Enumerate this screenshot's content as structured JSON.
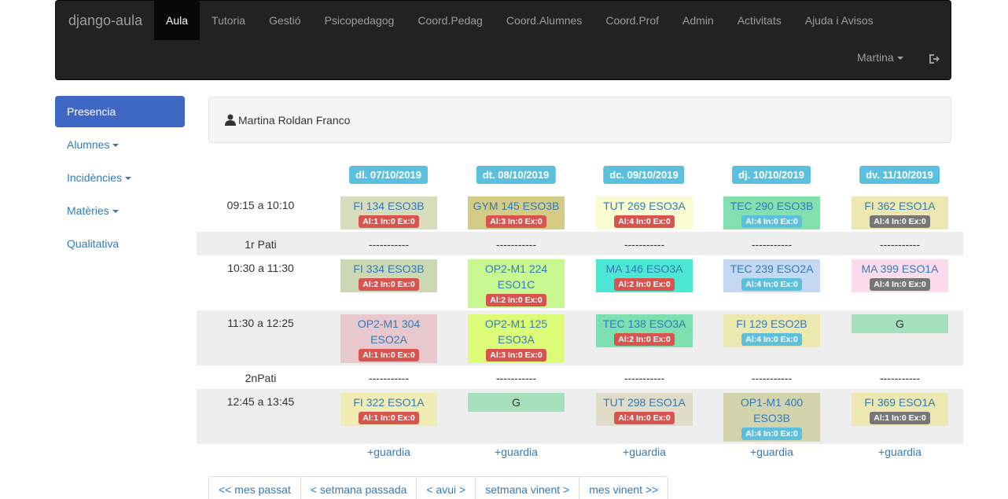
{
  "navbar": {
    "brand": "django-aula",
    "items": [
      "Aula",
      "Tutoria",
      "Gestió",
      "Psicopedagog",
      "Coord.Pedag",
      "Coord.Alumnes",
      "Coord.Prof",
      "Admin",
      "Activitats",
      "Ajuda i Avisos"
    ],
    "user": "Martina"
  },
  "sidebar": {
    "items": [
      "Presencia",
      "Alumnes",
      "Incidències",
      "Matèries",
      "Qualitativa"
    ]
  },
  "teacher": {
    "name": "Martina Roldan Franco"
  },
  "schedule": {
    "days": [
      "dl. 07/10/2019",
      "dt. 08/10/2019",
      "dc. 09/10/2019",
      "dj. 10/10/2019",
      "dv. 11/10/2019"
    ],
    "rows": [
      {
        "time": "09:15 a 10:10",
        "cells": [
          {
            "text": "FI 134 ESO3B",
            "badge": "Al:1 In:0 Ex:0",
            "badge_color": "red",
            "bg": "#d6dcbc"
          },
          {
            "text": "GYM 145 ESO3B",
            "badge": "Al:3 In:0 Ex:0",
            "badge_color": "red",
            "bg": "#d4cc84"
          },
          {
            "text": "TUT 269 ESO3A",
            "badge": "Al:4 In:0 Ex:0",
            "badge_color": "red",
            "bg": "#f8fcd0"
          },
          {
            "text": "TEC 290 ESO3B",
            "badge": "Al:4 In:0 Ex:0",
            "badge_color": "blue",
            "bg": "#84e0ac"
          },
          {
            "text": "FI 362 ESO1A",
            "badge": "Al:4 In:0 Ex:0",
            "badge_color": "gray",
            "bg": "#ece8b0"
          }
        ]
      },
      {
        "time": "1r Pati",
        "dashes": [
          "-----------",
          "-----------",
          "-----------",
          "-----------",
          "-----------"
        ]
      },
      {
        "time": "10:30 a 11:30",
        "cells": [
          {
            "text": "FI 334 ESO3B",
            "badge": "Al:2 In:0 Ex:0",
            "badge_color": "red",
            "bg": "#ccd8b4"
          },
          {
            "text": "OP2-M1 224 ESO1C",
            "badge": "Al:2 In:0 Ex:0",
            "badge_color": "red",
            "bg": "#c8f890"
          },
          {
            "text": "MA 146 ESO3A",
            "badge": "Al:2 In:0 Ex:0",
            "badge_color": "red",
            "bg": "#4ce8d4"
          },
          {
            "text": "TEC 239 ESO2A",
            "badge": "Al:4 In:0 Ex:0",
            "badge_color": "blue",
            "bg": "#c4d8f4"
          },
          {
            "text": "MA 399 ESO1A",
            "badge": "Al:4 In:0 Ex:0",
            "badge_color": "gray",
            "bg": "#fcdcec"
          }
        ]
      },
      {
        "time": "11:30 a 12:25",
        "cells": [
          {
            "text": "OP2-M1 304 ESO2A",
            "badge": "Al:1 In:0 Ex:0",
            "badge_color": "red",
            "bg": "#e8c8cc"
          },
          {
            "text": "OP2-M1 125 ESO3A",
            "badge": "Al:3 In:0 Ex:0",
            "badge_color": "red",
            "bg": "#dcfc78"
          },
          {
            "text": "TEC 138 ESO3A",
            "badge": "Al:2 In:0 Ex:0",
            "badge_color": "red",
            "bg": "#7ce0b0"
          },
          {
            "text": "FI 129 ESO2B",
            "badge": "Al:4 In:0 Ex:0",
            "badge_color": "blue",
            "bg": "#ece8b0"
          },
          {
            "text": "G",
            "badge": "",
            "badge_color": "",
            "bg": "#a4e0bc",
            "dark": true
          }
        ]
      },
      {
        "time": "2nPati",
        "dashes": [
          "-----------",
          "-----------",
          "-----------",
          "-----------",
          "-----------"
        ]
      },
      {
        "time": "12:45 a 13:45",
        "cells": [
          {
            "text": "FI 322 ESO1A",
            "badge": "Al:1 In:0 Ex:0",
            "badge_color": "red",
            "bg": "#f0ecb4"
          },
          {
            "text": "G",
            "badge": "",
            "badge_color": "",
            "bg": "#a4e0bc",
            "dark": true
          },
          {
            "text": "TUT 298 ESO1A",
            "badge": "Al:4 In:0 Ex:0",
            "badge_color": "red",
            "bg": "#e0dcc8"
          },
          {
            "text": "OP1-M1 400 ESO3B",
            "badge": "Al:4 In:0 Ex:0",
            "badge_color": "blue",
            "bg": "#d4d4ac"
          },
          {
            "text": "FI 369 ESO1A",
            "badge": "Al:1 In:0 Ex:0",
            "badge_color": "gray",
            "bg": "#ece8b0"
          }
        ]
      }
    ],
    "guard_label": "+guardia"
  },
  "pager": [
    "<< mes passat",
    "< setmana passada",
    "< avui >",
    "setmana vinent >",
    "mes vinent >>"
  ]
}
